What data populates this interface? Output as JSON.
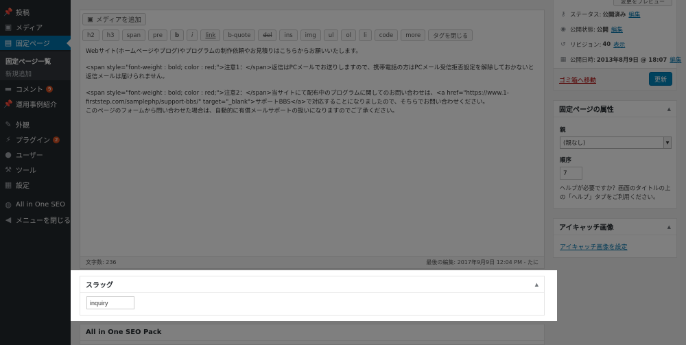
{
  "sidebar": {
    "items": [
      {
        "label": "投稿",
        "icon": "pin-icon",
        "glyph": "📌"
      },
      {
        "label": "メディア",
        "icon": "media-icon",
        "glyph": "▣"
      },
      {
        "label": "固定ページ",
        "icon": "pages-icon",
        "glyph": "▤"
      },
      {
        "label": "コメント",
        "icon": "comment-icon",
        "glyph": "▬",
        "badge": "9"
      },
      {
        "label": "運用事例紹介",
        "icon": "pin-icon",
        "glyph": "📌"
      },
      {
        "label": "外観",
        "icon": "brush-icon",
        "glyph": "✎"
      },
      {
        "label": "プラグイン",
        "icon": "plug-icon",
        "glyph": "⚡",
        "badge": "2"
      },
      {
        "label": "ユーザー",
        "icon": "user-icon",
        "glyph": "●"
      },
      {
        "label": "ツール",
        "icon": "wrench-icon",
        "glyph": "⚒"
      },
      {
        "label": "設定",
        "icon": "settings-icon",
        "glyph": "▦"
      },
      {
        "label": "All in One SEO",
        "icon": "seo-icon",
        "glyph": "◍"
      },
      {
        "label": "メニューを閉じる",
        "icon": "collapse-icon",
        "glyph": "◀"
      }
    ],
    "sub": {
      "list": "固定ページ一覧",
      "add": "新規追加"
    }
  },
  "editor": {
    "media_button": "メディアを追加",
    "quicktags": [
      "h2",
      "h3",
      "span",
      "pre",
      "b",
      "i",
      "link",
      "b-quote",
      "del",
      "ins",
      "img",
      "ul",
      "ol",
      "li",
      "code",
      "more",
      "タグを閉じる"
    ],
    "paragraphs": [
      "Webサイト(ホームページやブログ)やプログラムの制作依頼やお見積りはこちらからお願いいたします。",
      "<span style=\"font-weight : bold; color : red;\">注意1：</span>返信はPCメールでお送りしますので、携帯電話の方はPCメール受信拒否設定を解除しておかないと返信メールは届けられません。",
      "<span style=\"font-weight : bold; color : red;\">注意2：</span>当サイトにて配布中のプログラムに関してのお問い合わせは、<a href=\"https://www.1-firststep.com/samplephp/support-bbs/\" target=\"_blank\">サポートBBS</a>で対応することになりましたので、そちらでお問い合わせください。\nこのページのフォームから問い合わせた場合は、自動的に有償メールサポートの扱いになりますのでご了承ください。"
    ],
    "word_count": "文字数: 236",
    "last_edit": "最後の編集: 2017年9月9日 12:04 PM - たに"
  },
  "slug": {
    "title": "スラッグ",
    "value": "inquiry"
  },
  "aioseo": {
    "title": "All in One SEO Pack"
  },
  "publish": {
    "preview": "変更をプレビュー",
    "status_label": "ステータス:",
    "status_value": "公開済み",
    "visibility_label": "公開状態:",
    "visibility_value": "公開",
    "revisions_label": "リビジョン:",
    "revisions_value": "40",
    "date_label": "公開日時:",
    "date_value": "2013年8月9日 @ 18:07",
    "edit": "編集",
    "show": "表示",
    "trash": "ゴミ箱へ移動",
    "update": "更新"
  },
  "attributes": {
    "title": "固定ページの属性",
    "parent_label": "親",
    "parent_value": "(親なし)",
    "order_label": "順序",
    "order_value": "7",
    "help": "ヘルプが必要ですか？画面のタイトルの上の「ヘルプ」タブをご利用ください。"
  },
  "thumbnail": {
    "title": "アイキャッチ画像",
    "link": "アイキャッチ画像を設定"
  },
  "colors": {
    "sidebar": "#23282d",
    "accent": "#0073aa",
    "update": "#0085ba",
    "trash": "#aa0000",
    "badge": "#d54e21"
  }
}
